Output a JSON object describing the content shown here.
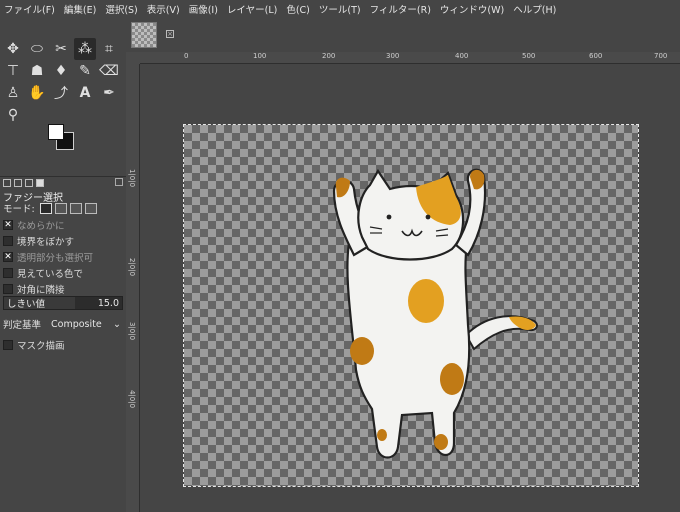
{
  "menu": [
    "ファイル(F)",
    "編集(E)",
    "選択(S)",
    "表示(V)",
    "画像(I)",
    "レイヤー(L)",
    "色(C)",
    "ツール(T)",
    "フィルター(R)",
    "ウィンドウ(W)",
    "ヘルプ(H)"
  ],
  "tool_options": {
    "title": "ファジー選択",
    "mode_label": "モード:",
    "options": [
      {
        "label": "なめらかに",
        "checked": true
      },
      {
        "label": "境界をぼかす",
        "checked": false
      },
      {
        "label": "透明部分も選択可",
        "checked": true
      },
      {
        "label": "見えている色で",
        "checked": false
      },
      {
        "label": "対角に隣接",
        "checked": false
      }
    ],
    "threshold_label": "しきい値",
    "threshold_value": "15.0",
    "criteria_label": "判定基準",
    "criteria_value": "Composite",
    "mask_label": "マスク描画"
  },
  "ruler": {
    "top_labels": [
      "0",
      "100",
      "200",
      "300",
      "400",
      "500",
      "600",
      "700"
    ],
    "left_labels": [
      "1|0|0",
      "2|0|0",
      "3|0|0",
      "4|0|0"
    ]
  },
  "colors": {
    "foreground": "#ffffff",
    "background": "#111111",
    "cat_orange": "#e3a021",
    "cat_brown": "#c07a15"
  }
}
